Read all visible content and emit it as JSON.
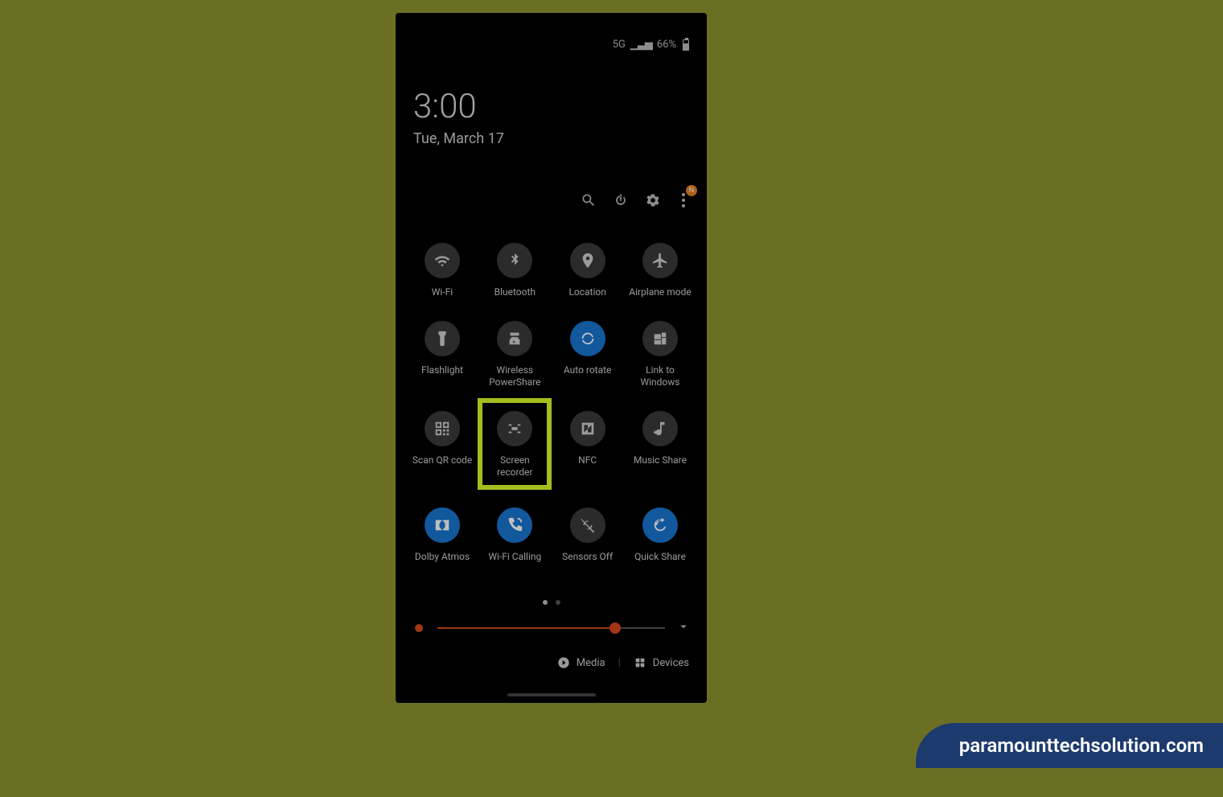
{
  "status": {
    "network": "5G",
    "battery_text": "66%"
  },
  "clock": {
    "time": "3:00",
    "date": "Tue, March 17"
  },
  "actions": {
    "more_badge": "N"
  },
  "tiles": [
    [
      {
        "id": "wifi",
        "label": "Wi-Fi",
        "active": false
      },
      {
        "id": "bluetooth",
        "label": "Bluetooth",
        "active": false
      },
      {
        "id": "location",
        "label": "Location",
        "active": false
      },
      {
        "id": "airplane",
        "label": "Airplane mode",
        "active": false
      }
    ],
    [
      {
        "id": "flashlight",
        "label": "Flashlight",
        "active": false
      },
      {
        "id": "powershare",
        "label": "Wireless PowerShare",
        "active": false
      },
      {
        "id": "autorotate",
        "label": "Auto rotate",
        "active": true
      },
      {
        "id": "linkwindows",
        "label": "Link to Windows",
        "active": false
      }
    ],
    [
      {
        "id": "qrcode",
        "label": "Scan QR code",
        "active": false
      },
      {
        "id": "screenrecorder",
        "label": "Screen recorder",
        "active": false,
        "highlight": true
      },
      {
        "id": "nfc",
        "label": "NFC",
        "active": false
      },
      {
        "id": "musicshare",
        "label": "Music Share",
        "active": false
      }
    ],
    [
      {
        "id": "dolby",
        "label": "Dolby Atmos",
        "active": true
      },
      {
        "id": "wificalling",
        "label": "Wi-Fi Calling",
        "active": true
      },
      {
        "id": "sensorsoff",
        "label": "Sensors Off",
        "active": false
      },
      {
        "id": "quickshare",
        "label": "Quick Share",
        "active": true
      }
    ]
  ],
  "brightness": {
    "percent": 78
  },
  "bottom": {
    "media": "Media",
    "devices": "Devices"
  },
  "watermark": "paramounttechsolution.com"
}
